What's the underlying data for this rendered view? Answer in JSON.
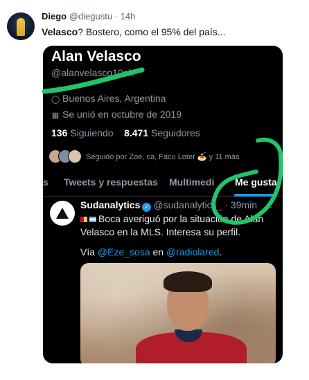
{
  "tweet": {
    "author_name": "Diego",
    "author_handle": "@diegustu",
    "separator": "·",
    "time": "14h",
    "text_bold": "Velasco",
    "text_rest": "? Bostero, como el 95% del país..."
  },
  "screenshot": {
    "profile": {
      "name": "Alan Velasco",
      "handle": "@alanvelasco10ok",
      "location": "Buenos Aires, Argentina",
      "joined": "Se unió en octubre de 2019",
      "following_count": "136",
      "following_label": "Siguiendo",
      "followers_count": "8.471",
      "followers_label": "Seguidores",
      "followed_by": "Seguido por Zoe, ca, Facu Loter 🍝 y 11 más"
    },
    "tabs": [
      {
        "label": "s"
      },
      {
        "label": "Tweets y respuestas"
      },
      {
        "label": "Multimedi"
      },
      {
        "label": "Me gusta"
      }
    ],
    "liked_tweet": {
      "name": "Sudanalytics",
      "handle": "@sudanalytics_",
      "separator": "·",
      "time": "39min",
      "menu": "⋮",
      "line1": "Boca averiguó por la situación de Alan",
      "line2": "Velasco en la MLS. Interesa su perfil.",
      "via_prefix": "Vía",
      "via_user1": "@Eze_sosa",
      "via_mid": "en",
      "via_user2": "@radiolared",
      "via_suffix": "."
    }
  },
  "colors": {
    "accent_blue": "#1d9bf0",
    "marker_green": "#21c46b",
    "dark_bg": "#000000",
    "muted_text": "#8b98a5"
  },
  "icons": [
    "location-pin-icon",
    "calendar-icon",
    "verified-badge-icon",
    "more-icon",
    "flag-icon"
  ]
}
